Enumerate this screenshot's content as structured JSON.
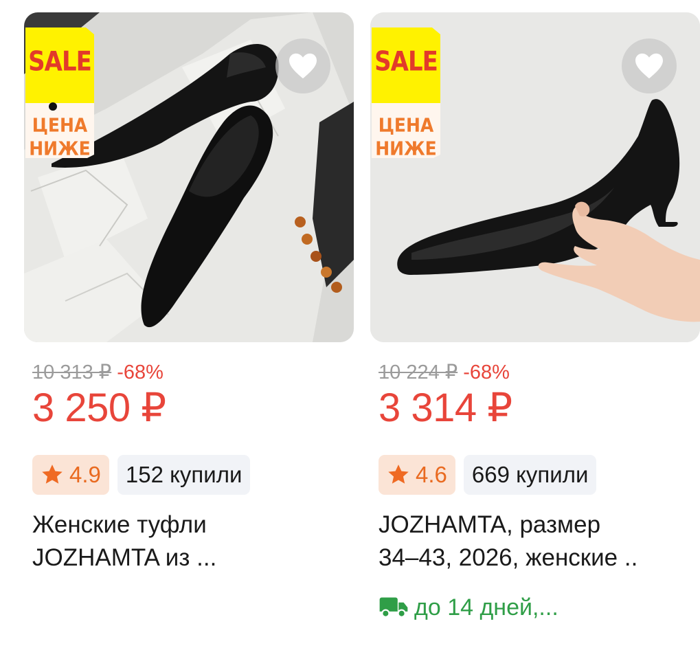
{
  "colors": {
    "price": "#e8453a",
    "old_price": "#9b9b9b",
    "rating_text": "#e96a20",
    "rating_bg": "#fbe4d6",
    "bought_bg": "#f1f3f7",
    "delivery": "#2f9e47",
    "badge_yellow": "#fff200"
  },
  "products": [
    {
      "badge": {
        "sale": "SALE",
        "line1": "ЦЕНА",
        "line2": "НИЖЕ"
      },
      "favorite_icon": "heart-icon",
      "old_price": "10 313 ₽",
      "discount": "-68%",
      "price": "3 250 ₽",
      "rating": "4.9",
      "rating_icon": "star-icon",
      "bought": "152 купили",
      "title_line1": "Женские туфли",
      "title_line2": "JOZHAMTA из ..."
    },
    {
      "badge": {
        "sale": "SALE",
        "line1": "ЦЕНА",
        "line2": "НИЖЕ"
      },
      "favorite_icon": "heart-icon",
      "old_price": "10 224 ₽",
      "discount": "-68%",
      "price": "3 314 ₽",
      "rating": "4.6",
      "rating_icon": "star-icon",
      "bought": "669 купили",
      "title_line1": "JOZHAMTA, размер",
      "title_line2": "34–43, 2026, женские ..",
      "delivery_icon": "truck-icon",
      "delivery": "до 14 дней,..."
    }
  ]
}
